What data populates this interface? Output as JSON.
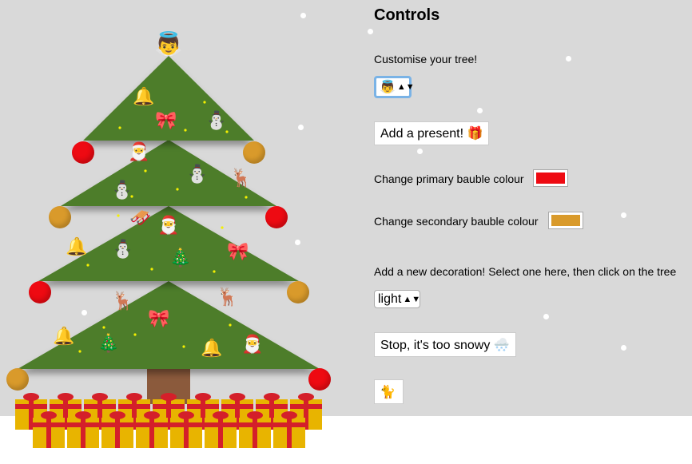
{
  "controls": {
    "title": "Controls",
    "customise_label": "Customise your tree!",
    "topper_select_value": "👼",
    "add_present_label": "Add a present! 🎁",
    "primary_bauble_label": "Change primary bauble colour",
    "primary_bauble_color": "#ee0a12",
    "secondary_bauble_label": "Change secondary bauble colour",
    "secondary_bauble_color": "#d99a2b",
    "decoration_instruction": "Add a new decoration! Select one here, then click on the tree",
    "decoration_select_value": "light",
    "stop_snow_label": "Stop, it's too snowy 🌨️",
    "pet_button_label": "🐈"
  },
  "tree": {
    "topper": "👼",
    "foliage_color": "#4e7d2a",
    "trunk_color": "#8b5a3c"
  },
  "colors": {
    "sky": "#d9d9d9",
    "snow": "#ffffff",
    "present_gold": "#e8b400",
    "present_ribbon": "#d41f2a"
  }
}
